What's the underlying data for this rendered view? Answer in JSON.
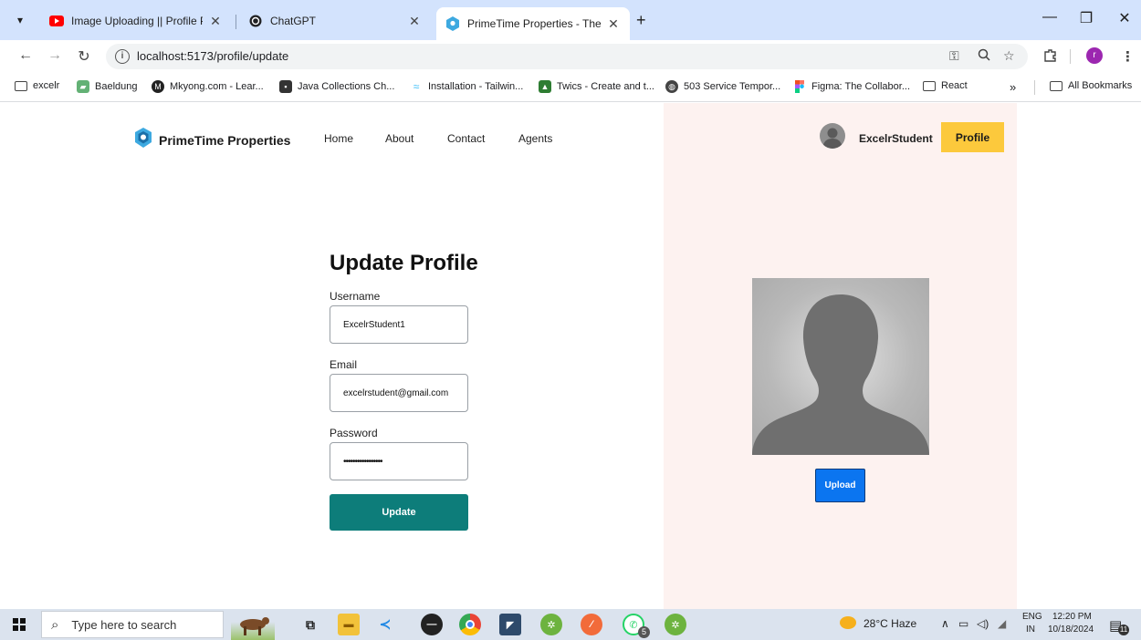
{
  "browser": {
    "tabs": [
      {
        "title": "Image Uploading || Profile Pictu",
        "icon": "youtube-icon",
        "active": false
      },
      {
        "title": "ChatGPT",
        "icon": "chatgpt-icon",
        "active": false
      },
      {
        "title": "PrimeTime Properties - The Rea",
        "icon": "primetime-logo-icon",
        "active": true
      }
    ],
    "close_glyph": "✕",
    "new_tab_glyph": "+",
    "url": "localhost:5173/profile/update",
    "bookmarks": [
      {
        "label": "excelr",
        "icon": "folder-icon"
      },
      {
        "label": "Baeldung",
        "icon": "baeldung-icon"
      },
      {
        "label": "Mkyong.com - Lear...",
        "icon": "mkyong-icon"
      },
      {
        "label": "Java Collections Ch...",
        "icon": "java-icon"
      },
      {
        "label": "Installation - Tailwin...",
        "icon": "tailwind-icon"
      },
      {
        "label": "Twics - Create and t...",
        "icon": "twics-icon"
      },
      {
        "label": "503 Service Tempor...",
        "icon": "globe-icon"
      },
      {
        "label": "Figma: The Collabor...",
        "icon": "figma-icon"
      },
      {
        "label": "React",
        "icon": "folder-icon"
      }
    ],
    "more_bookmarks": "»",
    "all_bookmarks": "All Bookmarks",
    "profile_initial": "r"
  },
  "navbar": {
    "brand": "PrimeTime Properties",
    "links": [
      "Home",
      "About",
      "Contact",
      "Agents"
    ],
    "username": "ExcelrStudent",
    "profile_button": "Profile"
  },
  "form": {
    "title": "Update Profile",
    "username_label": "Username",
    "username_value": "ExcelrStudent1",
    "email_label": "Email",
    "email_value": "excelrstudent@gmail.com",
    "password_label": "Password",
    "password_value": "•••••••••••••••••",
    "submit_label": "Update"
  },
  "profile_panel": {
    "upload_label": "Upload"
  },
  "taskbar": {
    "search_placeholder": "Type here to search",
    "weather": "28°C  Haze",
    "lang_top": "ENG",
    "lang_bottom": "IN",
    "time": "12:20 PM",
    "date": "10/18/2024",
    "whatsapp_badge": "5",
    "notification_count": "11"
  },
  "colors": {
    "tab_strip": "#d3e3fd",
    "profile_button": "#fcc93c",
    "update_button": "#0d7d7a",
    "upload_button": "#0b75f0",
    "panel": "#fdf2f0"
  }
}
